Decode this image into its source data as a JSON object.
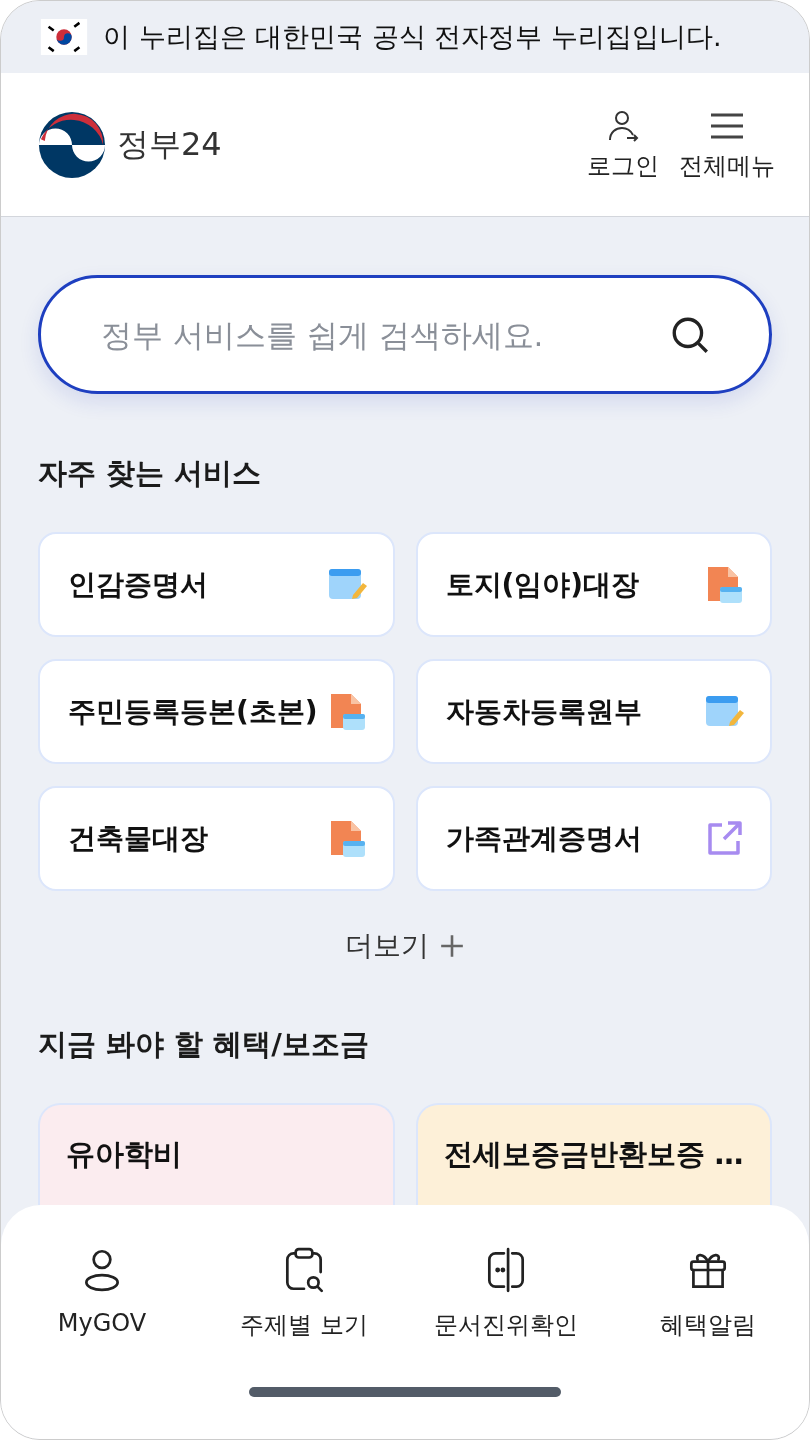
{
  "notice": {
    "text": "이 누리집은 대한민국 공식 전자정부 누리집입니다."
  },
  "header": {
    "logo_text": "정부24",
    "actions": [
      {
        "kind": "login",
        "label": "로그인"
      },
      {
        "kind": "menu",
        "label": "전체메뉴"
      }
    ]
  },
  "search": {
    "placeholder": "정부 서비스를 쉽게 검색하세요."
  },
  "frequent_services": {
    "title": "자주 찾는 서비스",
    "items": [
      {
        "label": "인감증명서",
        "kind": "pc"
      },
      {
        "label": "토지(임야)대장",
        "kind": "pdf"
      },
      {
        "label": "주민등록등본(초본)",
        "kind": "pdf"
      },
      {
        "label": "자동차등록원부",
        "kind": "pc"
      },
      {
        "label": "건축물대장",
        "kind": "pdf"
      },
      {
        "label": "가족관계증명서",
        "kind": "external"
      }
    ],
    "more": "더보기"
  },
  "benefits": {
    "title": "지금 봐야 할 혜택/보조금",
    "items": [
      {
        "title": "유아학비",
        "kind": "pink"
      },
      {
        "title": "전세보증금반환보증 …",
        "kind": "yellow"
      }
    ]
  },
  "bottom_nav": [
    {
      "kind": "person",
      "label": "MyGOV"
    },
    {
      "kind": "clipboard",
      "label": "주제별 보기"
    },
    {
      "kind": "doc",
      "label": "문서진위확인"
    },
    {
      "kind": "gift",
      "label": "혜택알림"
    }
  ]
}
